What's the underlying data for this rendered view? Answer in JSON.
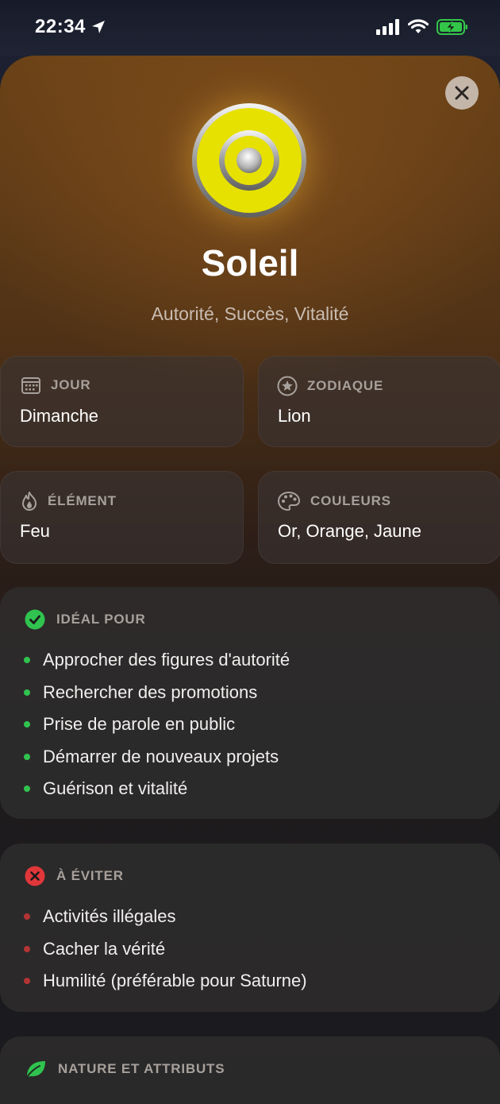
{
  "status": {
    "time": "22:34"
  },
  "colors": {
    "good": "#30c34f",
    "bad": "#e0373a",
    "accent": "#e6e100"
  },
  "planet": {
    "title": "Soleil",
    "subtitle": "Autorité, Succès, Vitalité",
    "icon": "sun-target-icon"
  },
  "info_cards": {
    "day": {
      "label": "JOUR",
      "value": "Dimanche",
      "icon": "calendar-icon"
    },
    "zodiac": {
      "label": "ZODIAQUE",
      "value": "Lion",
      "icon": "star-circle-icon"
    },
    "element": {
      "label": "ÉLÉMENT",
      "value": "Feu",
      "icon": "flame-icon"
    },
    "colors": {
      "label": "COULEURS",
      "value": "Or, Orange, Jaune",
      "icon": "palette-icon"
    }
  },
  "ideal": {
    "label": "IDÉAL POUR",
    "icon": "check-circle-icon",
    "items": [
      "Approcher des figures d'autorité",
      "Rechercher des promotions",
      "Prise de parole en public",
      "Démarrer de nouveaux projets",
      "Guérison et vitalité"
    ]
  },
  "avoid": {
    "label": "À ÉVITER",
    "icon": "x-circle-icon",
    "items": [
      "Activités illégales",
      "Cacher la vérité",
      "Humilité (préférable pour Saturne)"
    ]
  },
  "nature": {
    "label": "NATURE ET ATTRIBUTS",
    "icon": "leaf-icon"
  }
}
